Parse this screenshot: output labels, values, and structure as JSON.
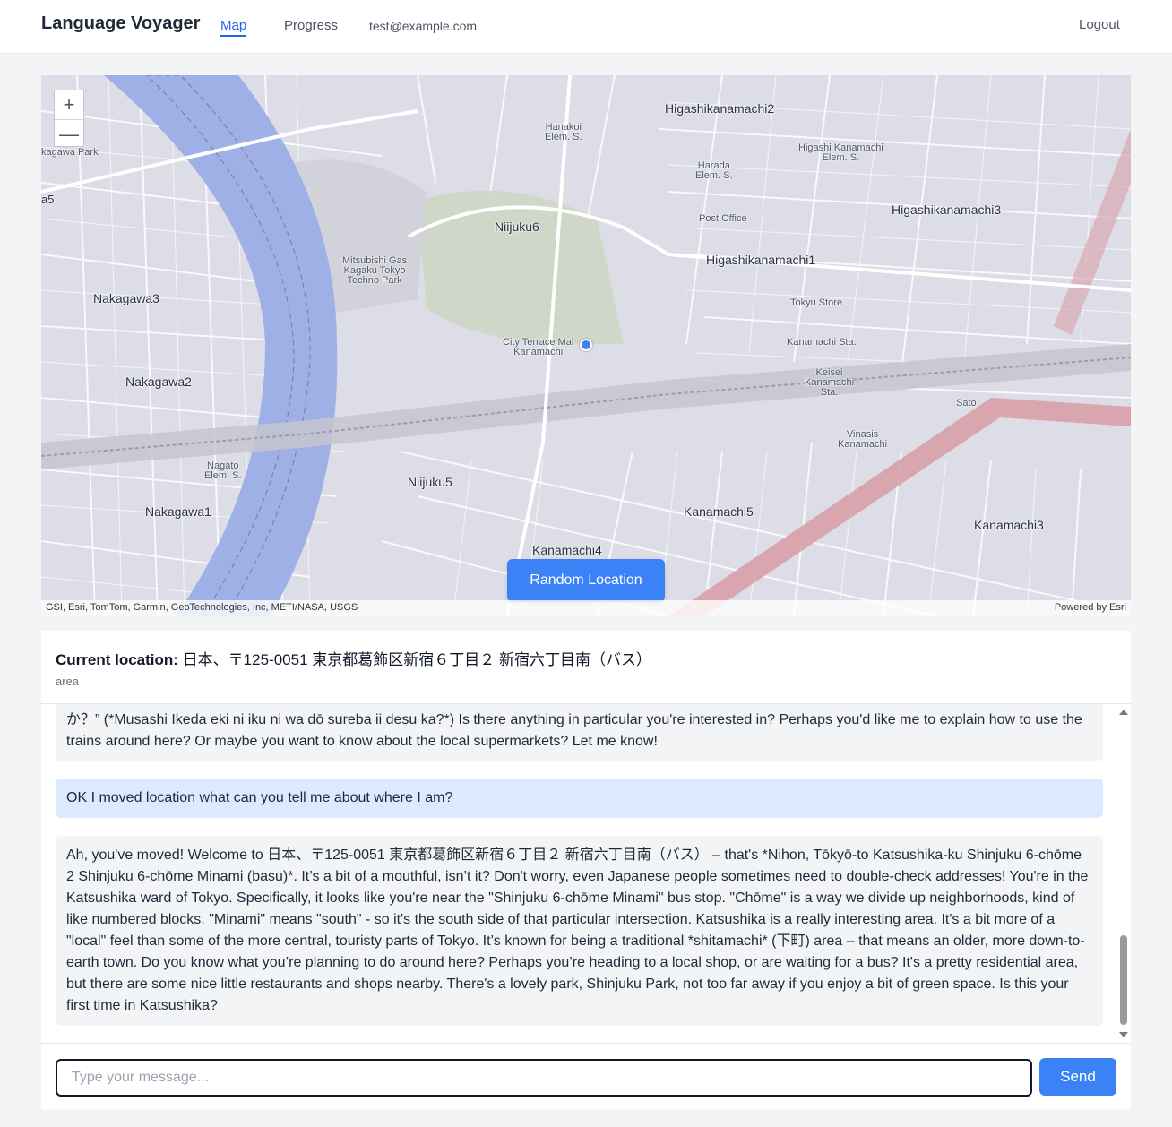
{
  "nav": {
    "brand": "Language Voyager",
    "links": [
      "Map",
      "Progress"
    ],
    "email": "test@example.com",
    "logout": "Logout"
  },
  "map": {
    "labels": {
      "higashikanamachi2": "Higashikanamachi2",
      "higashikanamachi3": "Higashikanamachi3",
      "higashikanamachi1": "Higashikanamachi1",
      "niijuku6": "Niijuku6",
      "niijuku5": "Niijuku5",
      "nakagawa3": "Nakagawa3",
      "nakagawa2": "Nakagawa2",
      "nakagawa1": "Nakagawa1",
      "nakagawa_park": "kagawa Park",
      "kanamachi5": "Kanamachi5",
      "kanamachi4": "Kanamachi4",
      "kanamachi3": "Kanamachi3",
      "hanakoi": "Hanakoi\nElem. S.",
      "higashi_kanamachi_es": "Higashi Kanamachi\nElem. S.",
      "harada": "Harada\nElem. S.",
      "post_office": "Post Office",
      "mitsubishi": "Mitsubishi Gas\nKagaku Tokyo\nTechno Park",
      "tokyu_store": "Tokyu Store",
      "kanamachi_sta": "Kanamachi Sta.",
      "keisei": "Keisei\nKanamachi\nSta.",
      "city_terrace": "City Terrace Mal\nKanamachi",
      "vinasis": "Vinasis\nKanamachi",
      "nagato": "Nagato\nElem. S.",
      "sato": "Sato",
      "a5": "a5"
    },
    "zoom_in": "+",
    "zoom_out": "—",
    "attribution": "GSI, Esri, TomTom, Garmin, GeoTechnologies, Inc, METI/NASA, USGS",
    "powered": "Powered by Esri",
    "random_button": "Random Location"
  },
  "location": {
    "label": "Current location:",
    "address": "日本、〒125-0051 東京都葛飾区新宿６丁目２ 新宿六丁目南（バス）",
    "type": "area"
  },
  "messages": [
    {
      "role": "assistant",
      "text": "か？” (*Musashi Ikeda eki ni iku ni wa dō sureba ii desu ka?*) Is there anything in particular you're interested in? Perhaps you'd like me to explain how to use the trains around here? Or maybe you want to know about the local supermarkets? Let me know!"
    },
    {
      "role": "user",
      "text": "OK I moved location what can you tell me about where I am?"
    },
    {
      "role": "assistant",
      "text": "Ah, you've moved! Welcome to 日本、〒125-0051 東京都葛飾区新宿６丁目２ 新宿六丁目南（バス） – that's *Nihon, Tōkyō-to Katsushika-ku Shinjuku 6-chōme 2 Shinjuku 6-chōme Minami (basu)*. It’s a bit of a mouthful, isn’t it? Don't worry, even Japanese people sometimes need to double-check addresses! You're in the Katsushika ward of Tokyo. Specifically, it looks like you're near the \"Shinjuku 6-chōme Minami\" bus stop. \"Chōme\" is a way we divide up neighborhoods, kind of like numbered blocks. \"Minami\" means \"south\" - so it's the south side of that particular intersection. Katsushika is a really interesting area. It's a bit more of a \"local\" feel than some of the more central, touristy parts of Tokyo. It’s known for being a traditional *shitamachi* (下町) area – that means an older, more down-to-earth town. Do you know what you’re planning to do around here? Perhaps you’re heading to a local shop, or are waiting for a bus? It's a pretty residential area, but there are some nice little restaurants and shops nearby. There's a lovely park, Shinjuku Park, not too far away if you enjoy a bit of green space. Is this your first time in Katsushika?"
    }
  ],
  "composer": {
    "placeholder": "Type your message...",
    "send": "Send"
  }
}
